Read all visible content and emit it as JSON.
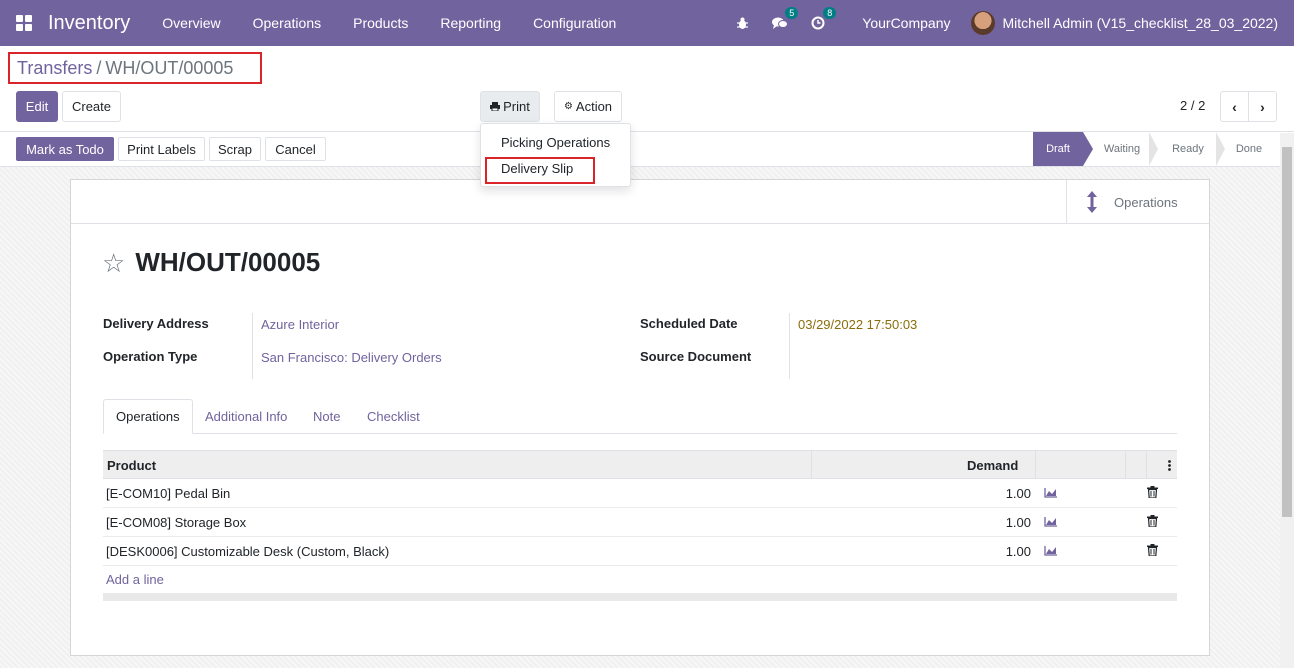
{
  "navbar": {
    "app_name": "Inventory",
    "menu": [
      "Overview",
      "Operations",
      "Products",
      "Reporting",
      "Configuration"
    ],
    "messages_badge": "5",
    "activities_badge": "8",
    "company": "YourCompany",
    "user": "Mitchell Admin (V15_checklist_28_03_2022)"
  },
  "breadcrumb": {
    "parent": "Transfers",
    "separator": "/",
    "current": "WH/OUT/00005"
  },
  "control": {
    "edit": "Edit",
    "create": "Create",
    "print": "Print",
    "action": "Action",
    "pager": "2 / 2"
  },
  "print_menu": {
    "items": [
      "Picking Operations",
      "Delivery Slip"
    ]
  },
  "header_buttons": [
    "Mark as Todo",
    "Print Labels",
    "Scrap",
    "Cancel"
  ],
  "stages": [
    "Draft",
    "Waiting",
    "Ready",
    "Done"
  ],
  "active_stage": "Draft",
  "smart_button": {
    "label": "Operations"
  },
  "record": {
    "name": "WH/OUT/00005",
    "delivery_address_label": "Delivery Address",
    "delivery_address": "Azure Interior",
    "operation_type_label": "Operation Type",
    "operation_type": "San Francisco: Delivery Orders",
    "scheduled_date_label": "Scheduled Date",
    "scheduled_date": "03/29/2022 17:50:03",
    "source_document_label": "Source Document",
    "source_document": ""
  },
  "tabs": [
    "Operations",
    "Additional Info",
    "Note",
    "Checklist"
  ],
  "table": {
    "columns": {
      "product": "Product",
      "demand": "Demand"
    },
    "rows": [
      {
        "product": "[E-COM10] Pedal Bin",
        "demand": "1.00"
      },
      {
        "product": "[E-COM08] Storage Box",
        "demand": "1.00"
      },
      {
        "product": "[DESK0006] Customizable Desk (Custom, Black)",
        "demand": "1.00"
      }
    ],
    "add_line": "Add a line"
  },
  "colors": {
    "brand": "#71639e",
    "highlight": "#d9252a",
    "date": "#8a6d0b"
  }
}
